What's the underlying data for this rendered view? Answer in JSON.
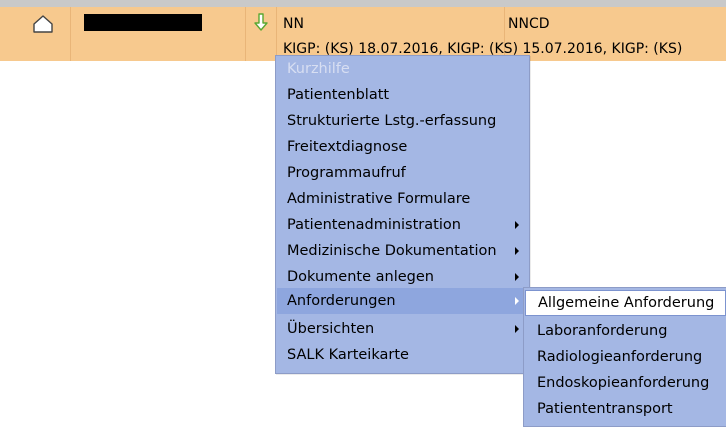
{
  "row": {
    "col_a": "NN",
    "col_b": "NNCD",
    "detail": "KIGP: (KS) 18.07.2016, KIGP: (KS) 15.07.2016, KIGP: (KS)"
  },
  "context_menu": {
    "items": [
      {
        "label": "Kurzhilfe",
        "disabled": true,
        "submenu": false
      },
      {
        "label": "Patientenblatt",
        "disabled": false,
        "submenu": false
      },
      {
        "label": "Strukturierte Lstg.-erfassung",
        "disabled": false,
        "submenu": false
      },
      {
        "label": "Freitextdiagnose",
        "disabled": false,
        "submenu": false
      },
      {
        "label": "Programmaufruf",
        "disabled": false,
        "submenu": false
      },
      {
        "label": "Administrative Formulare",
        "disabled": false,
        "submenu": false
      },
      {
        "label": "Patientenadministration",
        "disabled": false,
        "submenu": true
      },
      {
        "label": "Medizinische Dokumentation",
        "disabled": false,
        "submenu": true
      },
      {
        "label": "Dokumente anlegen",
        "disabled": false,
        "submenu": true
      },
      {
        "label": "Anforderungen",
        "disabled": false,
        "submenu": true,
        "highlighted": true
      },
      {
        "label": "Übersichten",
        "disabled": false,
        "submenu": true
      },
      {
        "label": "SALK Karteikarte",
        "disabled": false,
        "submenu": false
      }
    ]
  },
  "submenu": {
    "items": [
      {
        "label": "Allgemeine Anforderung",
        "highlighted": true
      },
      {
        "label": "Laboranforderung"
      },
      {
        "label": "Radiologieanforderung"
      },
      {
        "label": "Endoskopieanforderung"
      },
      {
        "label": "Patiententransport"
      }
    ]
  },
  "icons": {
    "home": "home-icon",
    "arrow": "arrow-down-icon",
    "arrow_color": "#5aa832"
  },
  "colors": {
    "row_background": "#f7c98e",
    "menu_background": "#a4b7e4",
    "menu_highlight": "#8ea6de",
    "submenu_highlight": "#ffffff"
  }
}
